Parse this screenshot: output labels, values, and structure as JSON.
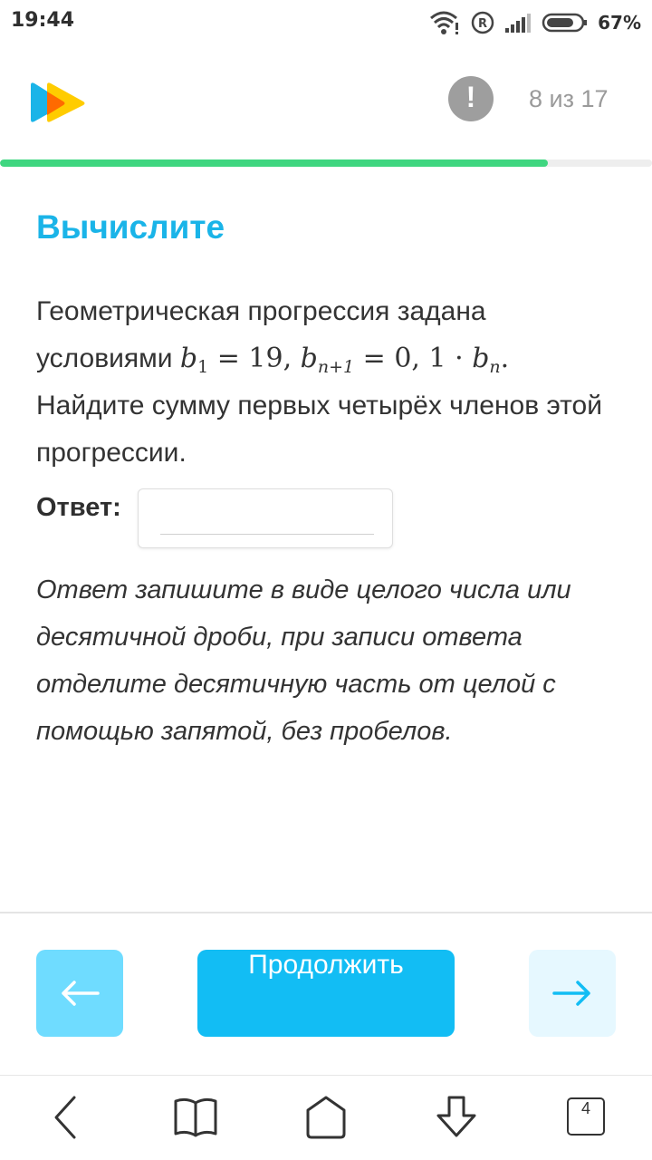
{
  "status_bar": {
    "time": "19:44",
    "battery_percent": "67%",
    "icons": [
      "wifi-icon",
      "roaming-r-icon",
      "signal-icon",
      "battery-icon"
    ]
  },
  "header": {
    "logo": "play-logo-icon",
    "alert_symbol": "!",
    "counter": "8 из 17",
    "progress_fraction": 0.84
  },
  "task": {
    "title": "Вычислите",
    "intro": "Геометрическая прогрессия задана условиями",
    "math": {
      "b1_var": "b",
      "b1_sub": "1",
      "b1_value": "= 19,",
      "bn1_var": "b",
      "bn1_sub": "n+1",
      "bn1_value": "= 0, 1 · ",
      "bn_var": "b",
      "bn_sub": "n",
      "end": "."
    },
    "question": "Найдите сумму первых четырёх членов этой прогрессии.",
    "answer_label": "Ответ:",
    "answer_value": "",
    "hint": "Ответ запишите в виде целого числа или десятичной дроби, при записи ответа отделите десятичную часть от целой с помощью запятой, без пробелов."
  },
  "footer": {
    "continue_label": "Продолжить",
    "prev_icon": "arrow-left-icon",
    "next_icon": "arrow-right-icon"
  },
  "navbar": {
    "tabs_count": "4"
  },
  "colors": {
    "accent": "#12bdf4",
    "title": "#1ab4e8",
    "progress": "#3fd680",
    "prev_button": "#6fdcff",
    "next_button": "#e6f8ff",
    "alert": "#9e9e9e"
  }
}
